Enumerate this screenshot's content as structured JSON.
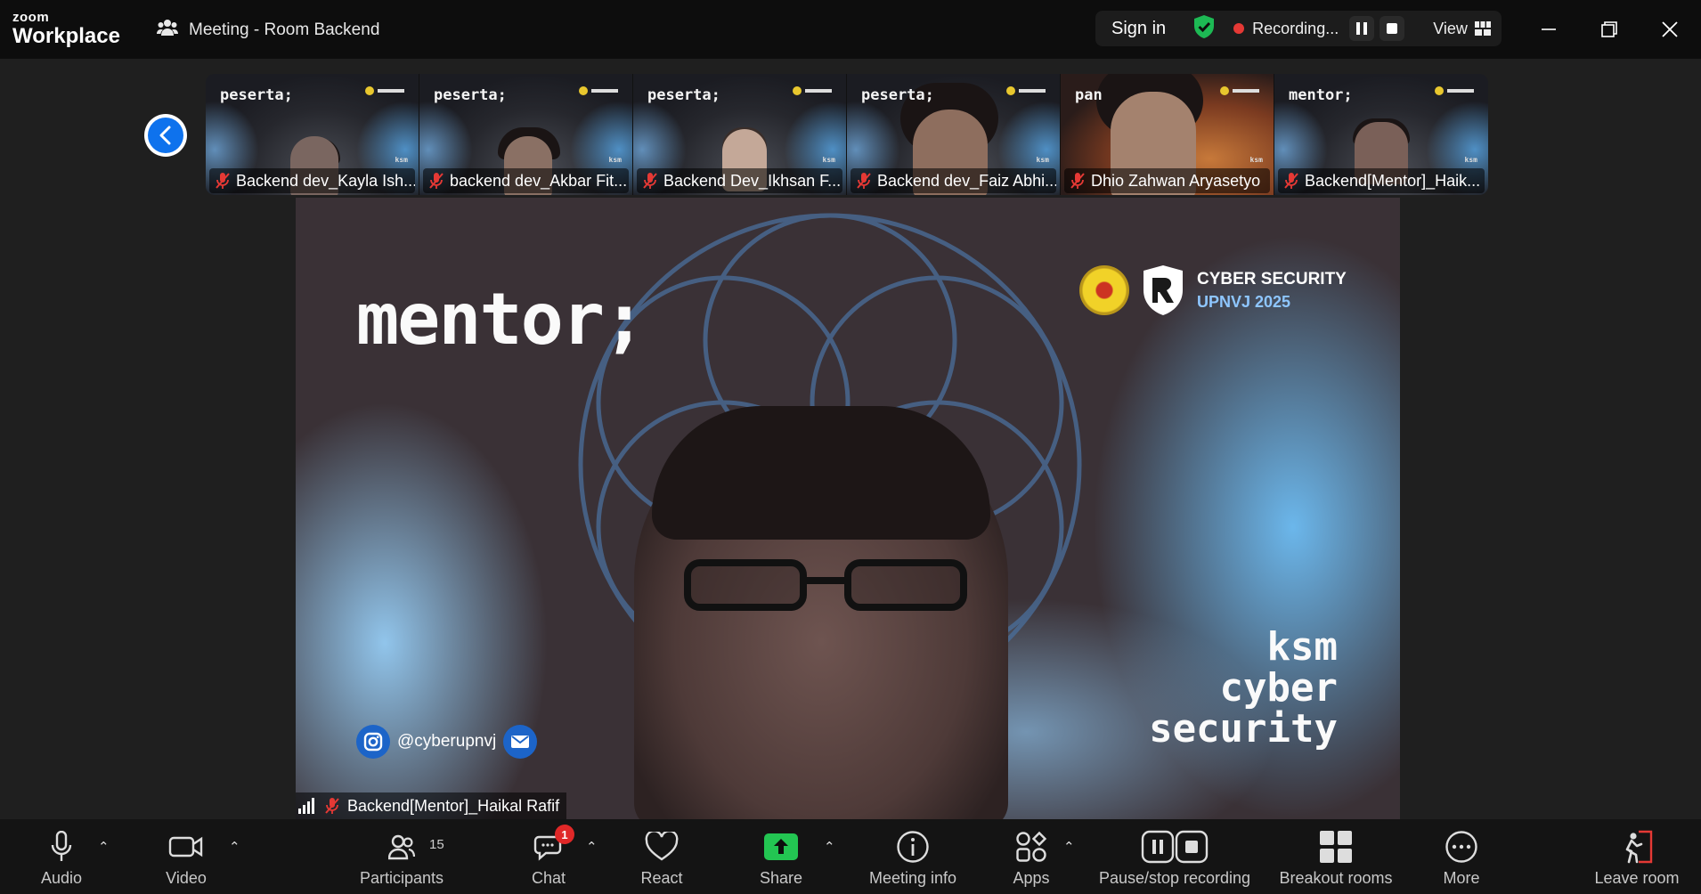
{
  "app": {
    "brand_small": "zoom",
    "brand_large": "Workplace"
  },
  "meeting": {
    "title": "Meeting - Room Backend"
  },
  "topbar": {
    "sign_in": "Sign in",
    "recording_label": "Recording...",
    "view_label": "View"
  },
  "thumbnails": [
    {
      "tag": "peserta;",
      "name": "Backend dev_Kayla Ish..."
    },
    {
      "tag": "peserta;",
      "name": "backend dev_Akbar Fit..."
    },
    {
      "tag": "peserta;",
      "name": "Backend Dev_Ikhsan F..."
    },
    {
      "tag": "peserta;",
      "name": "Backend dev_Faiz Abhi..."
    },
    {
      "tag": "pan",
      "name": "Dhio Zahwan Aryasetyo"
    },
    {
      "tag": "mentor;",
      "name": "Backend[Mentor]_Haik..."
    }
  ],
  "thumb_logo_text": "ksm",
  "speaker": {
    "tag": "mentor;",
    "brand_line1": "CYBER SECURITY",
    "brand_line2": "UPNVJ 2025",
    "ksm_line1": "ksm",
    "ksm_line2": "cyber",
    "ksm_line3": "security",
    "handle": "@cyberupnvj",
    "name": "Backend[Mentor]_Haikal Rafif"
  },
  "toolbar": {
    "audio": "Audio",
    "video": "Video",
    "participants": "Participants",
    "participants_count": "15",
    "chat": "Chat",
    "chat_badge": "1",
    "react": "React",
    "share": "Share",
    "meeting_info": "Meeting info",
    "apps": "Apps",
    "pause_stop_recording": "Pause/stop recording",
    "breakout_rooms": "Breakout rooms",
    "more": "More",
    "leave_room": "Leave room"
  },
  "colors": {
    "accent_blue": "#0e72ed",
    "share_green": "#23c552",
    "record_red": "#e53935",
    "shield_green": "#1db954"
  }
}
